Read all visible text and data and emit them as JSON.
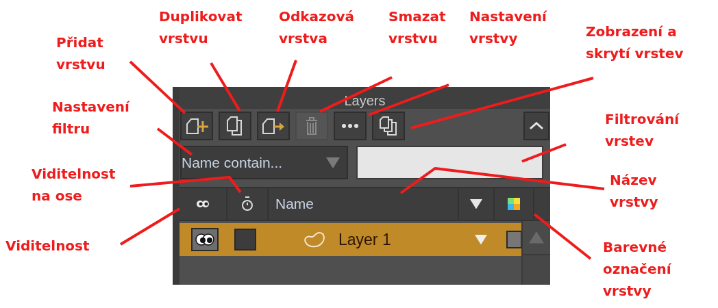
{
  "panel": {
    "title": "Layers",
    "toolbar": [
      {
        "kind": "add",
        "disabled": false
      },
      {
        "kind": "duplicate",
        "disabled": false
      },
      {
        "kind": "reference",
        "disabled": false
      },
      {
        "kind": "delete",
        "disabled": true
      },
      {
        "kind": "more",
        "disabled": false
      },
      {
        "kind": "show-hide",
        "disabled": false
      }
    ],
    "filter": {
      "value": "Name contain..."
    },
    "columns": {
      "name": "Name"
    },
    "layers": [
      {
        "name": "Layer 1",
        "selected": true,
        "visible": true,
        "camstand_visible": false
      }
    ]
  },
  "annotations": [
    {
      "text": "Přidat\nvrstvu"
    },
    {
      "text": "Duplikovat\nvrstvu"
    },
    {
      "text": "Odkazová\nvrstva"
    },
    {
      "text": "Smazat\nvrstvu"
    },
    {
      "text": "Nastavení\nvrstvy"
    },
    {
      "text": "Zobrazení a\nskrytí vrstev"
    },
    {
      "text": "Nastavení\nfiltru"
    },
    {
      "text": "Filtrování\nvrstev"
    },
    {
      "text": "Viditelnost\nna ose"
    },
    {
      "text": "Název\nvrstvy"
    },
    {
      "text": "Viditelnost"
    },
    {
      "text": "Barevné\noznačení\nvrstvy"
    }
  ]
}
